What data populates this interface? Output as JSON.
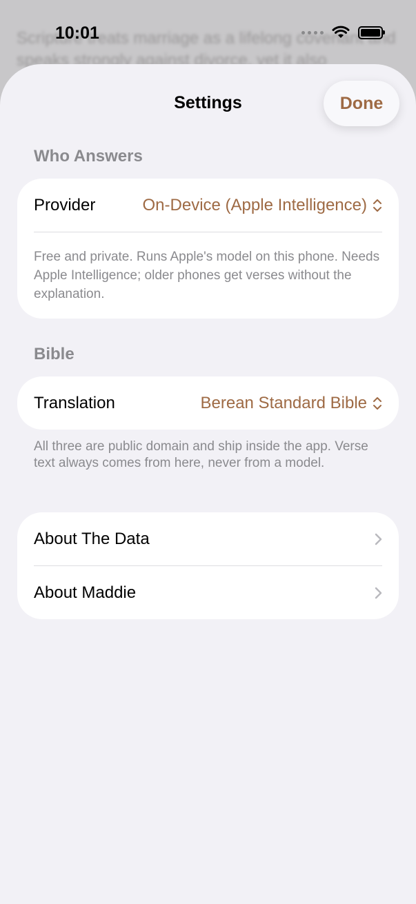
{
  "background": {
    "text": "Scripture treats marriage as a lifelong covenant and speaks strongly against divorce, yet it also"
  },
  "status_bar": {
    "time": "10:01"
  },
  "sheet": {
    "title": "Settings",
    "done_label": "Done",
    "accent_color": "#9e6a44"
  },
  "who_answers": {
    "header": "Who Answers",
    "provider_label": "Provider",
    "provider_value": "On-Device (Apple Intelligence)",
    "footnote": "Free and private. Runs Apple's model on this phone. Needs Apple Intelligence; older phones get verses without the explanation."
  },
  "bible": {
    "header": "Bible",
    "translation_label": "Translation",
    "translation_value": "Berean Standard Bible",
    "footnote": "All three are public domain and ship inside the app. Verse text always comes from here, never from a model."
  },
  "about": {
    "items": [
      {
        "label": "About The Data"
      },
      {
        "label": "About Maddie"
      }
    ]
  },
  "icons": {
    "wifi": "wifi-icon",
    "battery": "battery-icon",
    "signal": "signal-dots-icon",
    "updown": "chevron-up-down-icon",
    "right": "chevron-right-icon"
  }
}
